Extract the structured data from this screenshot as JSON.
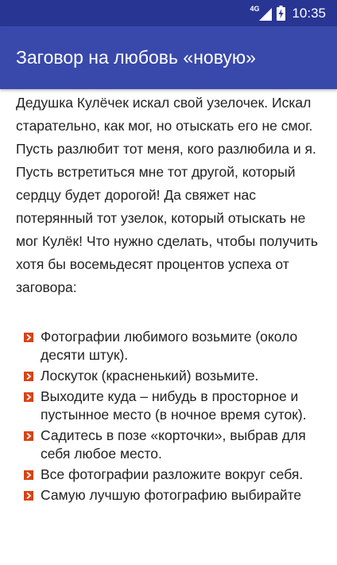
{
  "status_bar": {
    "network": "4G",
    "time": "10:35"
  },
  "app_bar": {
    "title": "Заговор на любовь «новую»"
  },
  "content": {
    "intro": "Дедушка Кулёчек искал свой узелочек. Искал старательно, как мог, но отыскать его не смог. Пусть разлюбит тот меня, кого разлюбила и я. Пусть встретиться мне тот другой, который сердцу будет дорогой! Да свяжет нас потерянный тот узелок, который отыскать не мог Кулёк! Что нужно сделать, чтобы получить хотя бы восемьдесят процентов успеха от заговора:",
    "steps": [
      "Фотографии любимого возьмите (около десяти штук).",
      "Лоскуток (красненький) возьмите.",
      "Выходите куда – нибудь в просторное и пустынное место (в ночное время суток).",
      "Садитесь в позе «корточки», выбрав для себя любое место.",
      "Все фотографии разложите вокруг себя.",
      "Самую лучшую фотографию выбирайте"
    ]
  },
  "colors": {
    "status_bar": "#283593",
    "app_bar": "#3949ab",
    "bullet": "#d84315",
    "text": "#222222"
  },
  "icons": {
    "signal": "signal-icon",
    "battery": "battery-charging-icon",
    "bullet": "bullet-arrow-icon"
  }
}
